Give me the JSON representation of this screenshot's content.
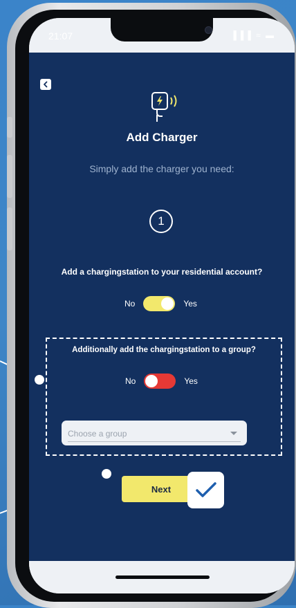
{
  "status_bar": {
    "time": "21:07",
    "icons": "▐▐▐ ≈ ▬"
  },
  "header": {
    "back_icon": "chevron-left-icon",
    "device_icon": "charger-icon",
    "title": "Add Charger",
    "subtitle": "Simply add the charger you need:"
  },
  "step": {
    "number": "1"
  },
  "residential": {
    "question": "Add a chargingstation to your residential account?",
    "no_label": "No",
    "yes_label": "Yes",
    "value": true,
    "toggle_color": "#f2e86c"
  },
  "group": {
    "question": "Additionally add the chargingstation to a group?",
    "no_label": "No",
    "yes_label": "Yes",
    "value": false,
    "toggle_color": "#e53935",
    "select_placeholder": "Choose a group"
  },
  "actions": {
    "next_label": "Next",
    "confirm_icon": "checkmark-icon"
  },
  "colors": {
    "app_background": "#13305f",
    "accent_yellow": "#f2e86c",
    "accent_red": "#e53935",
    "outer_background": "#3b84c9"
  }
}
